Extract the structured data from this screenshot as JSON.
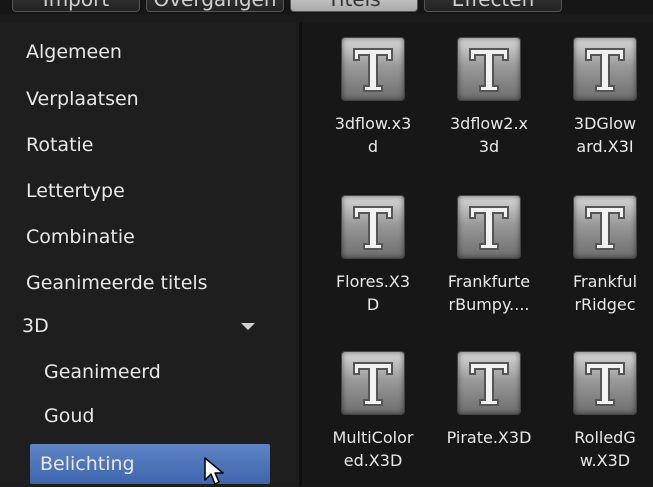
{
  "tabs": [
    {
      "label": "Import",
      "active": false
    },
    {
      "label": "Overgangen",
      "active": false
    },
    {
      "label": "Titels",
      "active": true
    },
    {
      "label": "Effecten",
      "active": false
    }
  ],
  "sidebar": {
    "items": [
      {
        "label": "Algemeen"
      },
      {
        "label": "Verplaatsen"
      },
      {
        "label": "Rotatie"
      },
      {
        "label": "Lettertype"
      },
      {
        "label": "Combinatie"
      },
      {
        "label": "Geanimeerde titels"
      },
      {
        "label": "3D",
        "expanded": true
      },
      {
        "label": "Geanimeerd"
      },
      {
        "label": "Goud"
      },
      {
        "label": "Belichting",
        "selected": true
      }
    ]
  },
  "tiles": [
    {
      "name": "3dflow.x3\nd"
    },
    {
      "name": "3dflow2.x\n3d"
    },
    {
      "name": "3DGlow\nard.X3I"
    },
    {
      "name": "Flores.X3\nD"
    },
    {
      "name": "Frankfurte\nrBumpy...."
    },
    {
      "name": "Frankful\nrRidgec"
    },
    {
      "name": "MultiColor\ned.X3D"
    },
    {
      "name": "Pirate.X3D"
    },
    {
      "name": "RolledG\nw.X3D"
    }
  ],
  "icon": "title-T-icon",
  "colors": {
    "selection": "#4a72b8",
    "background": "#1b1b1b",
    "text": "#e6e6e6"
  }
}
